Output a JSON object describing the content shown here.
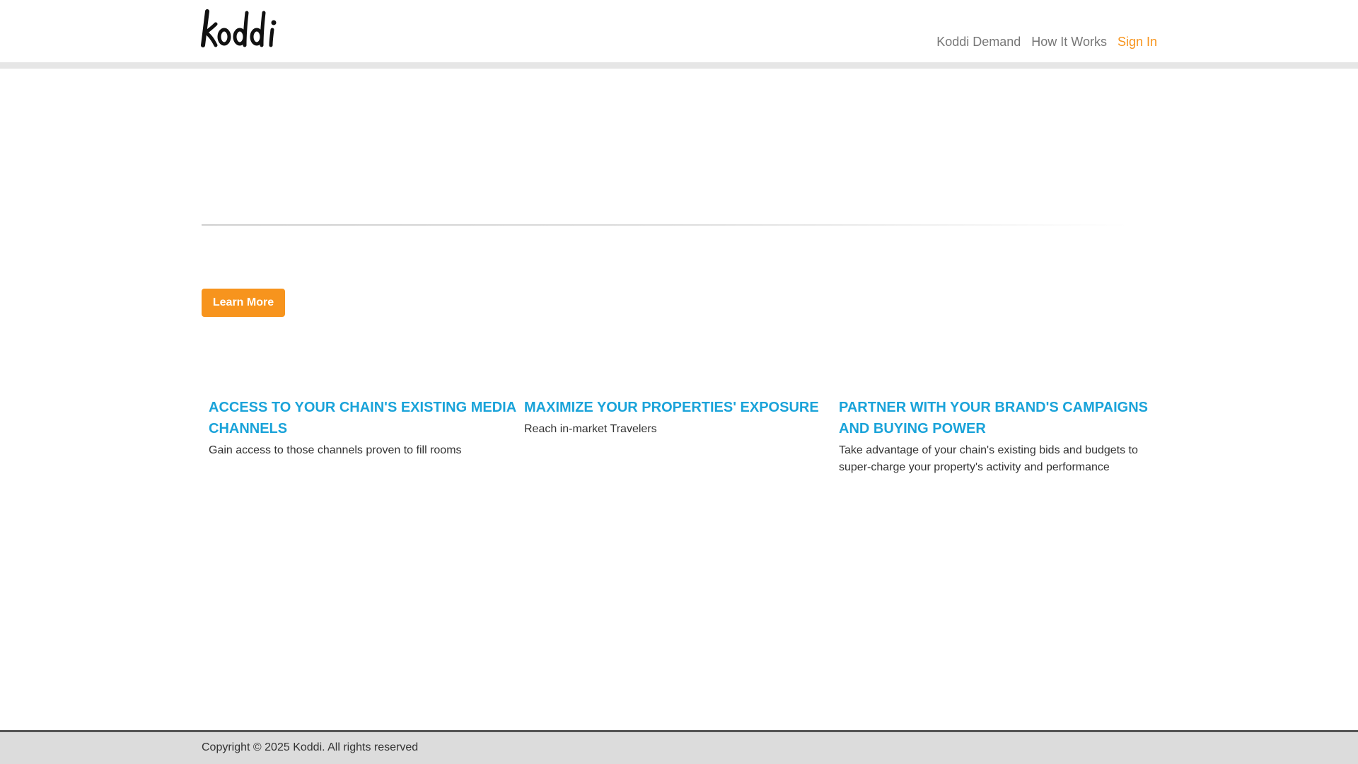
{
  "brand": {
    "logo_text": "koddi",
    "accent_color": "#f7941d",
    "heading_color": "#1aa3d9"
  },
  "nav": {
    "items": [
      {
        "label": "Koddi Demand"
      },
      {
        "label": "How It Works"
      },
      {
        "label": "Sign In"
      }
    ]
  },
  "hero": {
    "button_label": "Learn More"
  },
  "features": [
    {
      "title": "ACCESS TO YOUR CHAIN'S EXISTING MEDIA CHANNELS",
      "description": "Gain access to those channels proven to fill rooms"
    },
    {
      "title": "MAXIMIZE YOUR PROPERTIES' EXPOSURE",
      "description": "Reach in-market Travelers"
    },
    {
      "title": "PARTNER WITH YOUR BRAND'S CAMPAIGNS AND BUYING POWER",
      "description": "Take advantage of your chain's existing bids and budgets to super-charge your property's activity and performance"
    }
  ],
  "footer": {
    "copyright": "Copyright © 2025 Koddi. All rights reserved"
  }
}
